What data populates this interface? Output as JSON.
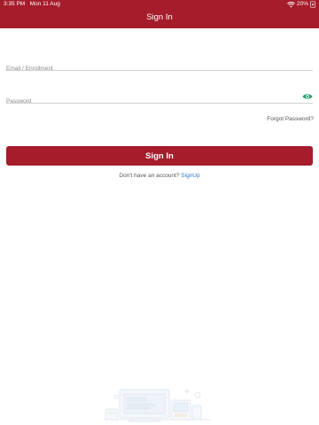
{
  "status_bar": {
    "time": "3:35 PM",
    "date": "Mon 11 Aug",
    "battery": "20%"
  },
  "header": {
    "title": "Sign In"
  },
  "form": {
    "email_placeholder": "Email / Enrollment",
    "password_placeholder": "Password",
    "forgot_label": "Forgot Password?",
    "submit_label": "Sign In"
  },
  "signup": {
    "prompt": "Don't have an account?",
    "link_label": "SignUp"
  },
  "colors": {
    "brand": "#a51c2b",
    "link": "#2f78c7",
    "eye_icon": "#1e9e6a"
  },
  "icons": [
    "wifi-icon",
    "battery-charging-icon",
    "eye-icon"
  ]
}
